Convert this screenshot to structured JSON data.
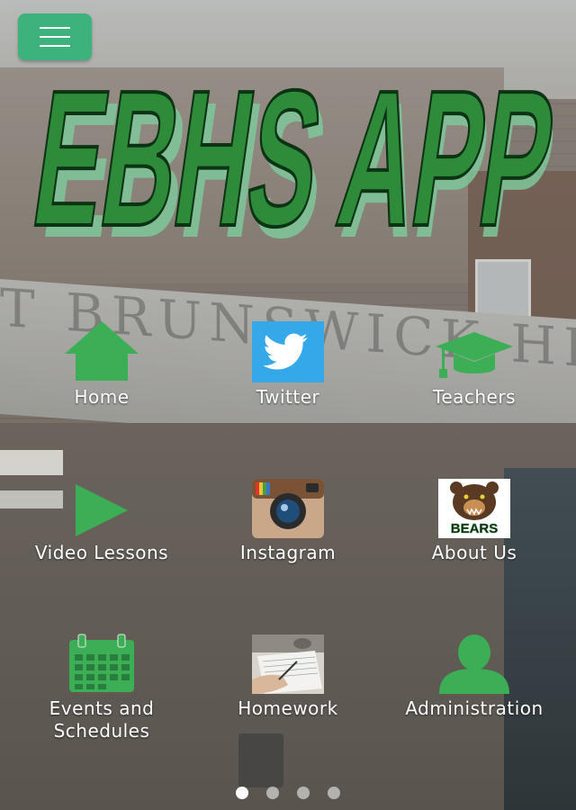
{
  "app": {
    "logo_text": "EBHS APP",
    "accent": "#2e8b3a",
    "menu_color": "#3db27c"
  },
  "menu": {
    "icon": "hamburger-icon"
  },
  "tiles": [
    {
      "label": "Home",
      "icon": "house-icon"
    },
    {
      "label": "Twitter",
      "icon": "twitter-bird-icon"
    },
    {
      "label": "Teachers",
      "icon": "graduation-cap-icon"
    },
    {
      "label": "Video Lessons",
      "icon": "play-icon"
    },
    {
      "label": "Instagram",
      "icon": "instagram-camera-icon"
    },
    {
      "label": "About Us",
      "icon": "bears-logo-icon",
      "logo_text": "BEARS"
    },
    {
      "label": "Events and\nSchedules",
      "icon": "calendar-icon"
    },
    {
      "label": "Homework",
      "icon": "homework-photo-icon"
    },
    {
      "label": "Administration",
      "icon": "person-icon"
    }
  ],
  "background": {
    "sign_text": "T BRUNSWICK HIGH SCHOOL"
  },
  "pagination": {
    "count": 4,
    "active": 1
  }
}
